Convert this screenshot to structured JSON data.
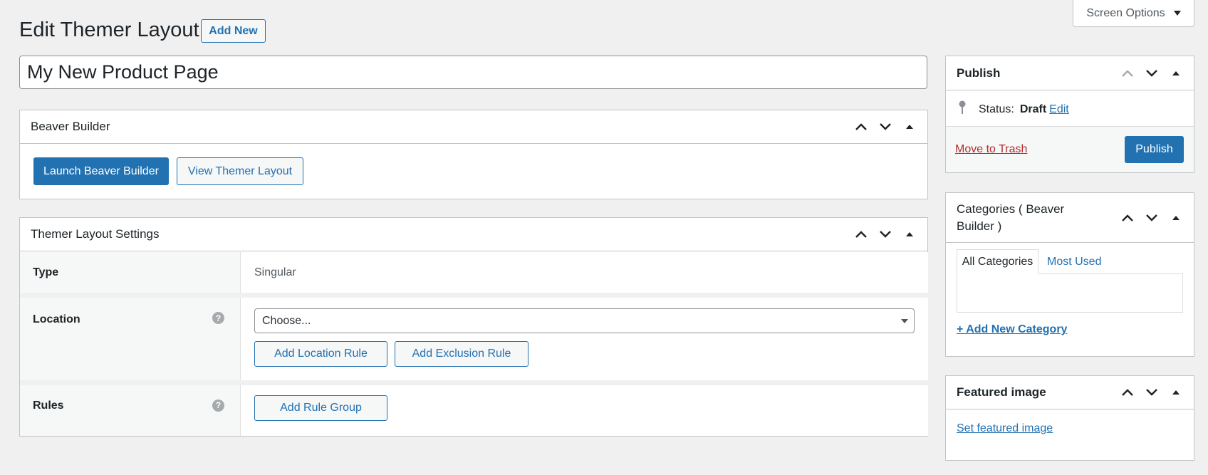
{
  "header": {
    "screen_options": "Screen Options",
    "page_title": "Edit Themer Layout",
    "add_new": "Add New"
  },
  "post": {
    "title": "My New Product Page"
  },
  "beaver_builder": {
    "title": "Beaver Builder",
    "launch_button": "Launch Beaver Builder",
    "view_button": "View Themer Layout"
  },
  "themer_settings": {
    "title": "Themer Layout Settings",
    "type_label": "Type",
    "type_value": "Singular",
    "location_label": "Location",
    "location_select": "Choose...",
    "add_location_rule": "Add Location Rule",
    "add_exclusion_rule": "Add Exclusion Rule",
    "rules_label": "Rules",
    "add_rule_group": "Add Rule Group",
    "help_glyph": "?"
  },
  "publish": {
    "title": "Publish",
    "status_label": "Status:",
    "status_value": "Draft",
    "status_edit": "Edit",
    "move_to_trash": "Move to Trash",
    "publish_button": "Publish"
  },
  "categories": {
    "title_line1": "Categories ( Beaver",
    "title_line2": "Builder )",
    "tab_all": "All Categories",
    "tab_most_used": "Most Used",
    "add_new": "+ Add New Category"
  },
  "featured_image": {
    "title": "Featured image",
    "set_link": "Set featured image"
  },
  "colors": {
    "primary": "#2271b1",
    "trash": "#b32d2e",
    "background": "#f0f0f1"
  }
}
